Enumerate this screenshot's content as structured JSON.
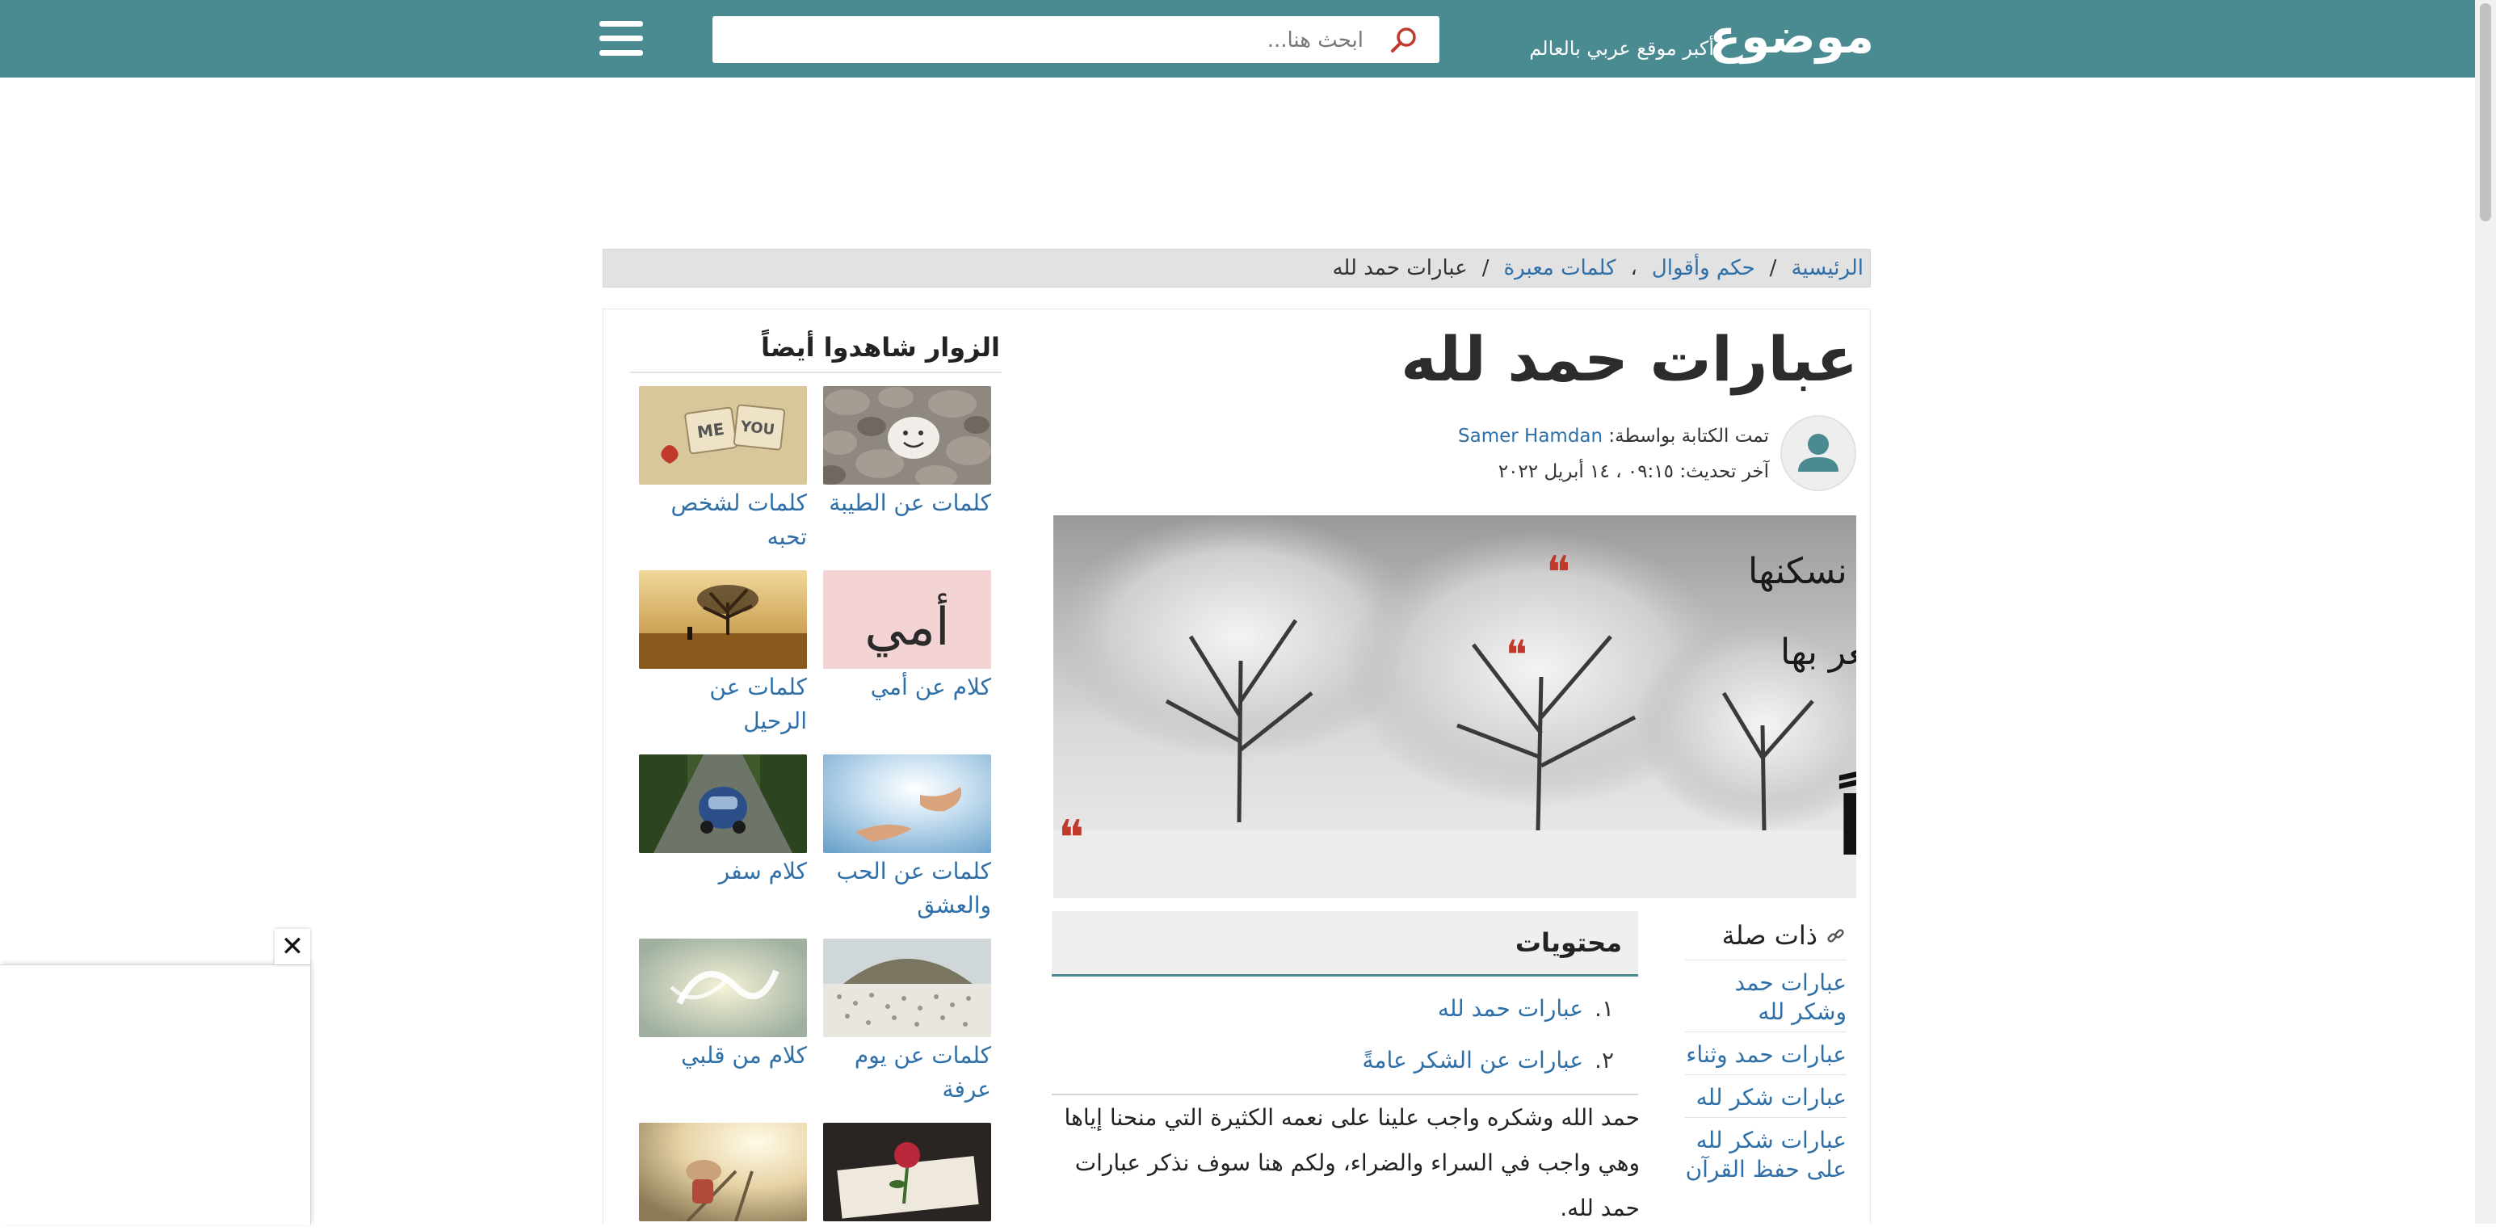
{
  "header": {
    "logo_text": "موضوع",
    "tagline": "أكبر موقع عربي بالعالم",
    "search_placeholder": "ابحث هنا..."
  },
  "breadcrumb": {
    "items": [
      "الرئيسية",
      "حكم وأقوال",
      "كلمات معبرة"
    ],
    "separators": [
      "/",
      "،",
      "/"
    ],
    "current": "عبارات حمد لله"
  },
  "article": {
    "title": "عبارات حمد لله",
    "written_by_label": "تمت الكتابة بواسطة:",
    "author": "Samer Hamdan",
    "last_update_label": "آخر تحديث:",
    "last_update": "٠٩:١٥ ، ١٤ أبريل ٢٠٢٢",
    "hero_lines": [
      "ونعم نسكنها",
      "ونعم لا نشعر بها",
      "الحمد لله دائماً وأبداً"
    ],
    "paragraph": "حمد الله وشكره واجب علينا على نعمه الكثيرة التي منحنا إياها وهي واجب في السراء والضراء، ولكم هنا سوف نذكر عبارات حمد لله."
  },
  "related": {
    "title": "ذات صلة",
    "items": [
      "عبارات حمد وشكر لله",
      "عبارات حمد وثناء",
      "عبارات شكر لله",
      "عبارات شكر لله على حفظ القرآن"
    ]
  },
  "contents": {
    "title": "محتويات",
    "items": [
      {
        "num": "١.",
        "label": "عبارات حمد لله"
      },
      {
        "num": "٢.",
        "label": "عبارات عن الشكر عامةً"
      }
    ]
  },
  "sidebar": {
    "title": "الزوار شاهدوا أيضاً",
    "cards": [
      {
        "label": "كلمات عن الطيبة",
        "image": "pebbles-smiley"
      },
      {
        "label": "كلمات لشخص تحبه",
        "image": "me-you-blocks"
      },
      {
        "label": "كلام عن أمي",
        "image": "calligraphy-omi"
      },
      {
        "label": "كلمات عن الرحيل",
        "image": "lonely-tree"
      },
      {
        "label": "كلمات عن الحب والعشق",
        "image": "hands-sunlight"
      },
      {
        "label": "كلام سفر",
        "image": "car-road"
      },
      {
        "label": "كلمات عن يوم عرفة",
        "image": "arafat-crowd"
      },
      {
        "label": "كلام من قلبي",
        "image": "calligraphy-light"
      },
      {
        "label": "",
        "image": "rails-person"
      },
      {
        "label": "",
        "image": "rose-book"
      }
    ]
  },
  "colors": {
    "brand": "#4a8a91",
    "link": "#2f6fa8",
    "accent_red": "#c0392b"
  },
  "float_panel": {
    "close_symbol": "✕"
  }
}
